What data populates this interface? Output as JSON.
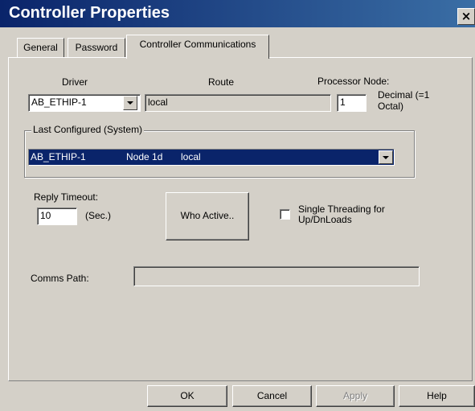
{
  "window": {
    "title": "Controller Properties",
    "close_glyph": "×"
  },
  "tabs": [
    {
      "label": "General",
      "active": false
    },
    {
      "label": "Password",
      "active": false
    },
    {
      "label": "Controller Communications",
      "active": true
    }
  ],
  "driver": {
    "label": "Driver",
    "value": "AB_ETHIP-1"
  },
  "route": {
    "label": "Route",
    "value": "local"
  },
  "processor_node": {
    "label": "Processor Node:",
    "value": "1",
    "hint_line1": "Decimal (=1",
    "hint_line2": "Octal)"
  },
  "last_configured": {
    "label": "Last Configured (System)",
    "driver": "AB_ETHIP-1",
    "node": "Node  1d",
    "route": "local"
  },
  "reply_timeout": {
    "label": "Reply Timeout:",
    "value": "10",
    "unit": "(Sec.)"
  },
  "who_active": {
    "label": "Who Active.."
  },
  "single_threading": {
    "label_line1": "Single Threading for",
    "label_line2": "Up/DnLoads",
    "checked": false
  },
  "comms_path": {
    "label": "Comms Path:",
    "value": ""
  },
  "buttons": {
    "ok": "OK",
    "cancel": "Cancel",
    "apply": "Apply",
    "help": "Help"
  },
  "colors": {
    "title_bar": "#0a246a",
    "dialog_face": "#d4d0c8",
    "selection": "#0a246a"
  }
}
